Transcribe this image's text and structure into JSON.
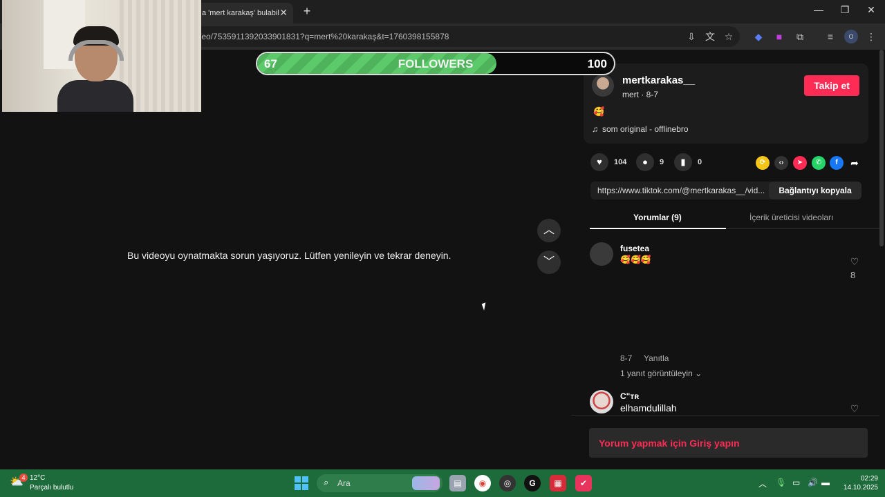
{
  "browser": {
    "tab_title": "a 'mert karakaş' bulabili",
    "tab_close": "✕",
    "new_tab": "+",
    "url": "/eo/7535911392033901831?q=mert%20karakaş&t=1760398155878",
    "window_controls": {
      "minimize": "—",
      "restore": "❐",
      "close": "✕"
    },
    "profile_initial": "O"
  },
  "overlay": {
    "followers_current": "67",
    "followers_label": "FOLLOWERS",
    "followers_goal": "100",
    "followers_progress": 0.67
  },
  "video": {
    "error_message": "Bu videoyu oynatmakta sorun yaşıyoruz. Lütfen yenileyin ve tekrar deneyin.",
    "nav_up": "︿",
    "nav_down": "﹀"
  },
  "post": {
    "username": "mertkarakas__",
    "subtitle": "mert · 8-7",
    "follow_label": "Takip et",
    "emoji": "🥰",
    "music": "som original - offlinebro",
    "likes": "104",
    "comments": "9",
    "saves": "0",
    "link": "https://www.tiktok.com/@mertkarakas__/vid...",
    "copy_label": "Bağlantıyı kopyala"
  },
  "tabs": {
    "comments": "Yorumlar (9)",
    "creator_videos": "İçerik üreticisi videoları"
  },
  "comments": [
    {
      "name": "fusetea",
      "text": "🥰🥰🥰",
      "likes": "8",
      "date": "8-7",
      "reply": "Yanıtla",
      "view_replies": "1 yanıt görüntüleyin"
    },
    {
      "name": "C\"ᴛʀ",
      "text": "elhamdulillah"
    }
  ],
  "login_prompt": "Yorum yapmak için Giriş yapın",
  "taskbar": {
    "weather_badge": "4",
    "temperature": "12°C",
    "weather_desc": "Parçalı bulutlu",
    "search_label": "Ara",
    "time": "02:29",
    "date": "14.10.2025"
  },
  "colors": {
    "accent": "#fe2c55",
    "progress_green": "#5cc96a",
    "taskbar": "#1d6b3b"
  }
}
